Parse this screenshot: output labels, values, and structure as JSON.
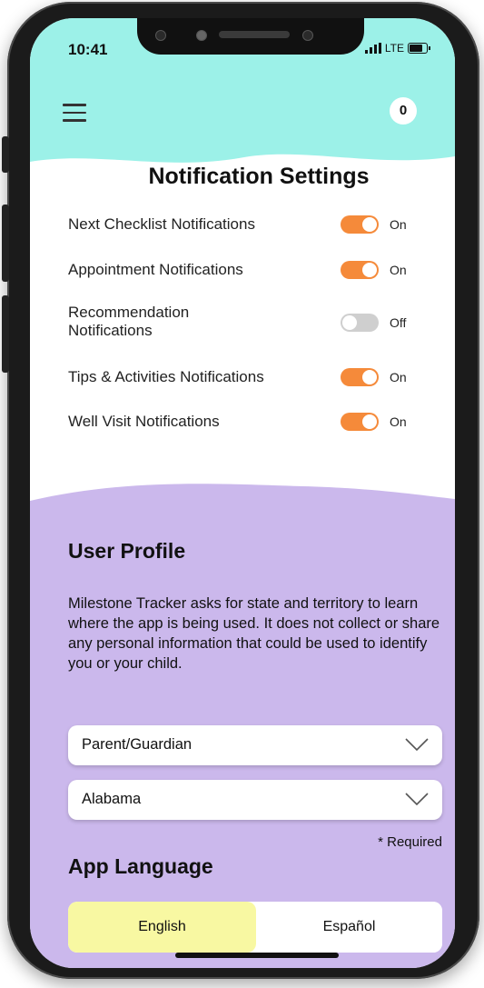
{
  "status_bar": {
    "time": "10:41",
    "network": "LTE"
  },
  "header": {
    "menu_icon": "hamburger-menu-icon",
    "badge_count": "0",
    "background_color": "#9cf1e8"
  },
  "notifications": {
    "title": "Notification Settings",
    "items": [
      {
        "label": "Next Checklist Notifications",
        "state": "On",
        "enabled": true
      },
      {
        "label": "Appointment Notifications",
        "state": "On",
        "enabled": true
      },
      {
        "label": "Recommendation Notifications",
        "state": "Off",
        "enabled": false
      },
      {
        "label": "Tips & Activities Notifications",
        "state": "On",
        "enabled": true
      },
      {
        "label": "Well Visit Notifications",
        "state": "On",
        "enabled": true
      }
    ],
    "toggle_on_color": "#f58a3a",
    "toggle_off_color": "#cfcfcf"
  },
  "profile": {
    "title": "User Profile",
    "description": "Milestone Tracker asks for state and territory to learn where the app is being used. It does not collect or share any personal information that could be used to identify you or your child.",
    "role_select": "Parent/Guardian",
    "state_select": "Alabama",
    "required_note": "* Required",
    "background_color": "#cbb8ec"
  },
  "language": {
    "title": "App Language",
    "options": [
      "English",
      "Español"
    ],
    "selected": "English",
    "selected_color": "#f8f8a2"
  }
}
